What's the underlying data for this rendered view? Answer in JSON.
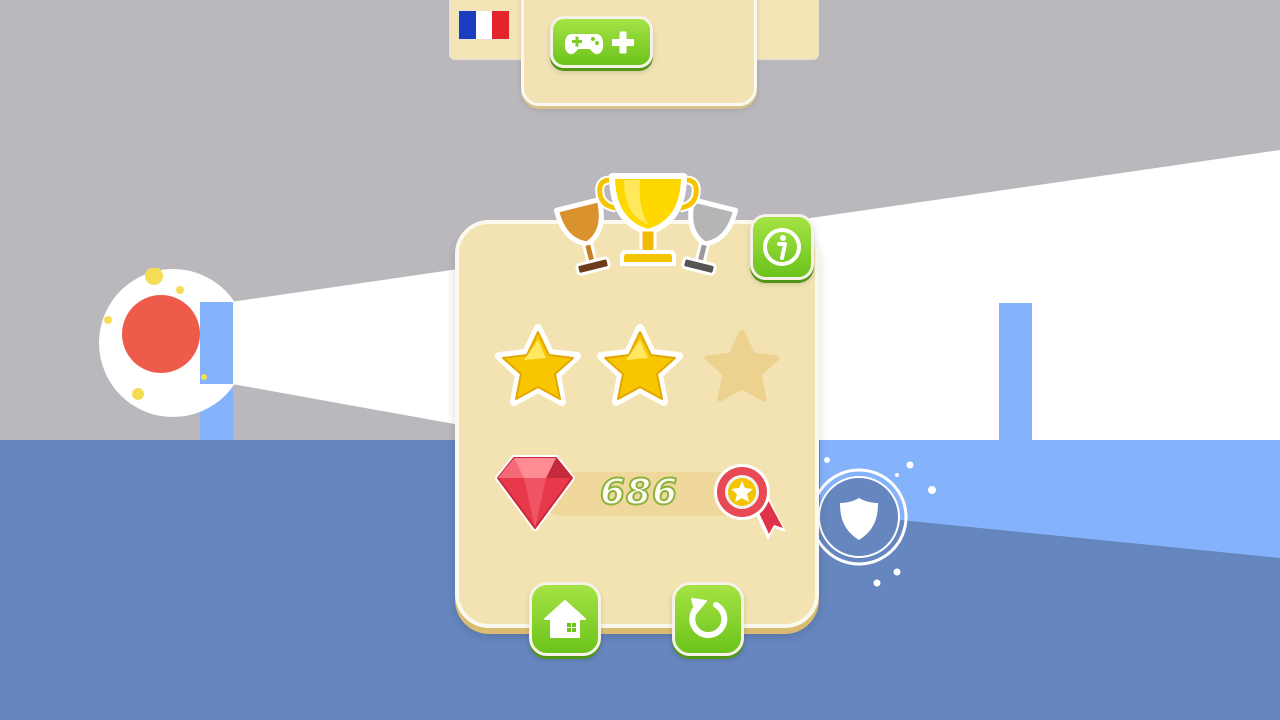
{
  "top_menu": {
    "language_flag": {
      "country": "France",
      "colors": [
        "#1b3ec1",
        "#ffffff",
        "#e3242b"
      ]
    },
    "add_game_icon": "gamepad-plus-icon"
  },
  "result_panel": {
    "trophies": [
      "bronze-trophy-icon",
      "gold-trophy-icon",
      "silver-trophy-icon"
    ],
    "info_icon": "info-icon",
    "stars": {
      "earned": 2,
      "total": 3
    },
    "gem_icon": "ruby-gem-icon",
    "score": "686",
    "medal_icon": "award-ribbon-icon",
    "home_icon": "home-icon",
    "replay_icon": "replay-icon"
  },
  "game_world": {
    "player_icon": "red-ball-icon",
    "shield_icon": "shield-icon"
  },
  "colors": {
    "sky": "#bab8bc",
    "ground": "#6686bf",
    "pillar": "#84b2fb",
    "panel": "#f3e3b2",
    "button_green": "#7ccd22",
    "star_gold": "#f7c600",
    "player": "#ef5b4b"
  }
}
